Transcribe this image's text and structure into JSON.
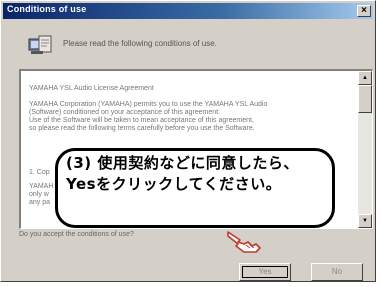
{
  "window": {
    "title": "Conditions of use",
    "close_glyph": "×"
  },
  "header": {
    "icon": "setup-computer-icon",
    "text": "Please read the following conditions of use."
  },
  "license_text": {
    "lines": [
      "YAMAHA YSL Audio License Agreement",
      "YAMAHA Corporation (YAMAHA) permits you to use the YAMAHA YSL Audio",
      "(Software) conditioned on your acceptance of this agreement.",
      "Use of the Software will be taken to mean acceptance of this agreement,",
      "so please read the following terms carefully before you use the Software.",
      "1. Cop",
      "YAMAH",
      "only w",
      "any pa"
    ]
  },
  "scrollbar": {
    "up_glyph": "▲",
    "down_glyph": "▼"
  },
  "question": "Do you accept the conditions of use?",
  "buttons": {
    "yes": "Yes",
    "no": "No"
  },
  "callout": {
    "text": "(3) 使用契約などに同意したら、Yesをクリックしてください。"
  },
  "colors": {
    "titlebar_start": "#0a246a",
    "titlebar_end": "#a6caf0",
    "dialog_face": "#d4d0c8"
  },
  "pointer": "pointing-hand-icon"
}
